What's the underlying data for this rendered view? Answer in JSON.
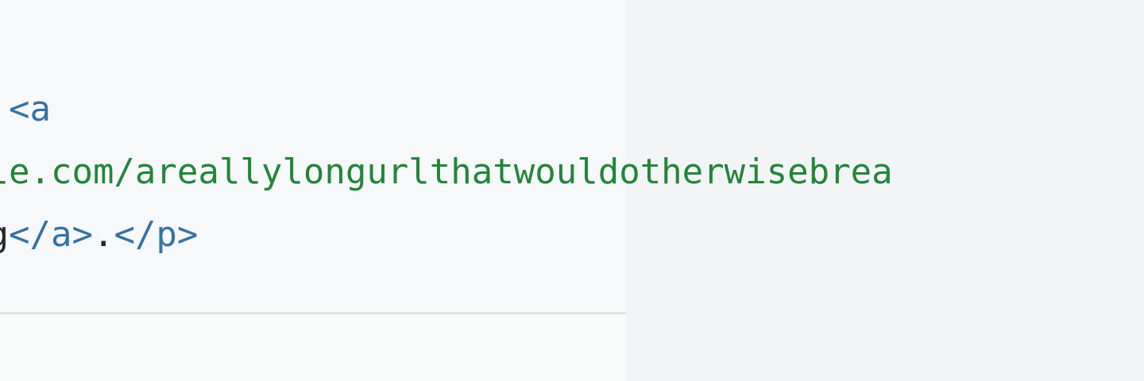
{
  "code_viewer": {
    "line1": {
      "tag": "<a"
    },
    "line2": {
      "url": "ple.com/areallylongurlthatwouldotherwisebrea"
    },
    "line3": {
      "text": "ng",
      "close_a": "</a>",
      "period": ".",
      "close_p": "</p>"
    }
  },
  "colors": {
    "tag": "#3572a5",
    "string": "#22863a",
    "text": "#24292e",
    "panel_bg": "#f7f8f9",
    "right_bg": "#f3f4f6",
    "divider": "#e1e2e4"
  }
}
